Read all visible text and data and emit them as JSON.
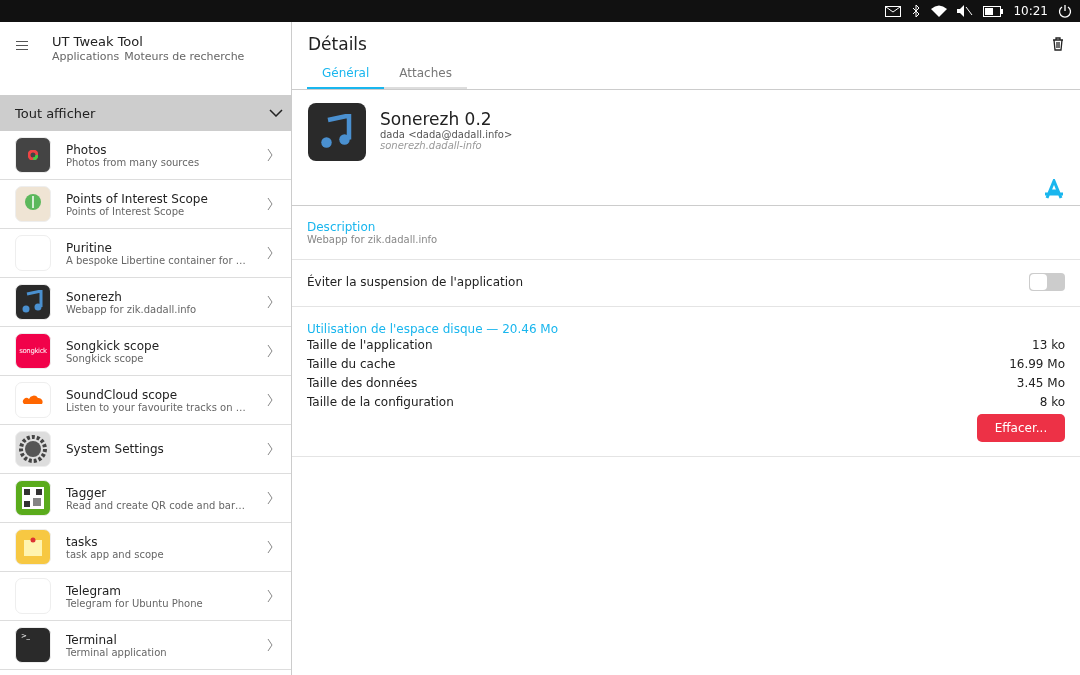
{
  "status_bar": {
    "time": "10:21"
  },
  "sidebar": {
    "title": "UT Tweak Tool",
    "subtitle_items": [
      "Applications",
      "Moteurs de recherche"
    ],
    "filter": "Tout afficher",
    "items": [
      {
        "name": "Photos",
        "description": "Photos from many sources",
        "kind": "photos"
      },
      {
        "name": "Points of Interest Scope",
        "description": "Points of Interest Scope",
        "kind": "map"
      },
      {
        "name": "Puritine",
        "description": "A bespoke Libertine container for …",
        "kind": "blank"
      },
      {
        "name": "Sonerezh",
        "description": "Webapp for zik.dadall.info",
        "kind": "music"
      },
      {
        "name": "Songkick scope",
        "description": "Songkick scope",
        "kind": "songkick",
        "icon_text": "songkick"
      },
      {
        "name": "SoundCloud scope",
        "description": "Listen to your favourite tracks on …",
        "kind": "cloud"
      },
      {
        "name": "System Settings",
        "kind": "gear"
      },
      {
        "name": "Tagger",
        "description": "Read and create QR code and bar…",
        "kind": "qr"
      },
      {
        "name": "tasks",
        "description": "task app and scope",
        "kind": "note"
      },
      {
        "name": "Telegram",
        "description": "Telegram for Ubuntu Phone",
        "kind": "blank"
      },
      {
        "name": "Terminal",
        "description": "Terminal application",
        "kind": "terminal",
        "icon_text": ">_"
      }
    ]
  },
  "details": {
    "title": "Détails",
    "tabs": [
      {
        "label": "Général",
        "selected": true
      },
      {
        "label": "Attaches",
        "selected": false
      }
    ],
    "app": {
      "name": "Sonerezh 0.2",
      "author": "dada <dada@dadall.info>",
      "package": "sonerezh.dadall-info"
    },
    "description": {
      "label": "Description",
      "text": "Webapp for zik.dadall.info"
    },
    "suspension": {
      "label": "Éviter la suspension de l'application",
      "on": false
    },
    "disk": {
      "label": "Utilisation de l'espace disque — 20.46 Mo",
      "rows": [
        {
          "label": "Taille de l'application",
          "value": "13 ko"
        },
        {
          "label": "Taille du cache",
          "value": "16.99 Mo"
        },
        {
          "label": "Taille des données",
          "value": "3.45 Mo"
        },
        {
          "label": "Taille de la configuration",
          "value": "8 ko"
        }
      ],
      "button": "Effacer..."
    }
  }
}
